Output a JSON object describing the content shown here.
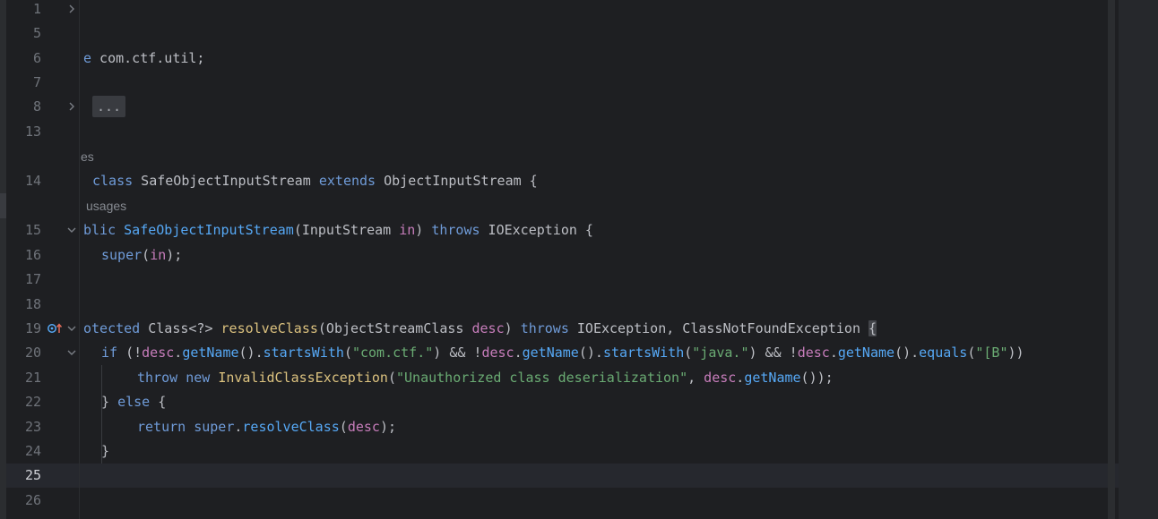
{
  "lines": [
    {
      "n": "1"
    },
    {
      "n": "5"
    },
    {
      "n": "6",
      "t1": "e",
      "t2": " com.ctf.util;"
    },
    {
      "n": "7"
    },
    {
      "n": "8",
      "fold": "..."
    },
    {
      "n": "13"
    },
    {
      "hint": "es"
    },
    {
      "n": "14",
      "kw1": "class",
      "cls": " SafeObjectInputStream ",
      "kw2": "extends",
      "sup": " ObjectInputStream {"
    },
    {
      "hint": "usages"
    },
    {
      "n": "15",
      "a": "blic ",
      "b": "SafeObjectInputStream",
      "c": "(InputStream ",
      "d": "in",
      "e": ") ",
      "f": "throws",
      "g": " IOException {"
    },
    {
      "n": "16",
      "a": "super",
      "b": "(",
      "c": "in",
      "d": ");"
    },
    {
      "n": "17"
    },
    {
      "n": "18"
    },
    {
      "n": "19",
      "a": "otected ",
      "b": "Class<?> ",
      "c": "resolveClass",
      "d": "(ObjectStreamClass ",
      "e": "desc",
      "f": ") ",
      "g": "throws",
      "h": " IOException, ClassNotFoundException ",
      "i": "{"
    },
    {
      "n": "20",
      "a": "if",
      "b": " (!",
      "c": "desc",
      "d": ".",
      "e": "getName",
      "f": "().",
      "g": "startsWith",
      "h": "(",
      "i": "\"com.ctf.\"",
      "j": ") && !",
      "k": "desc",
      "l": ".",
      "m": "getName",
      "n2": "().",
      "o": "startsWith",
      "p": "(",
      "q": "\"java.\"",
      "r": ") && !",
      "s": "desc",
      "t": ".",
      "u": "getName",
      "v": "().",
      "w": "equals",
      "x": "(",
      "y": "\"[B\"",
      "z": "))"
    },
    {
      "n": "21",
      "a": "throw",
      "b": " ",
      "c": "new",
      "d": " ",
      "e": "InvalidClassException",
      "f": "(",
      "g": "\"Unauthorized class deserialization\"",
      "h": ", ",
      "i": "desc",
      "j": ".",
      "k": "getName",
      "l": "());"
    },
    {
      "n": "22",
      "a": "} ",
      "b": "else",
      "c": " {"
    },
    {
      "n": "23",
      "a": "return",
      "b": " ",
      "c": "super",
      "d": ".",
      "e": "resolveClass",
      "f": "(",
      "g": "desc",
      "h": ");"
    },
    {
      "n": "24",
      "a": "}"
    },
    {
      "n": "25"
    },
    {
      "n": "26"
    }
  ]
}
